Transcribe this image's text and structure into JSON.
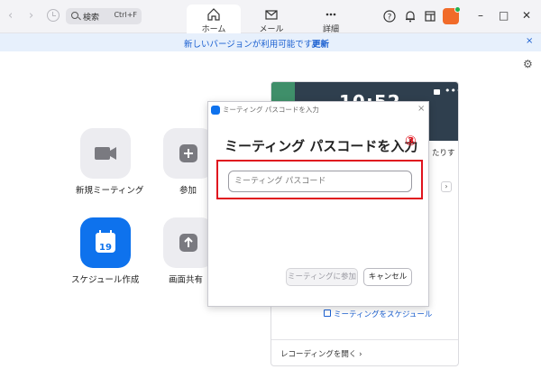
{
  "titlebar": {
    "search": {
      "label": "検索",
      "shortcut": "Ctrl+F"
    },
    "nav": [
      {
        "label": "ホーム",
        "icon": "home-icon",
        "active": true
      },
      {
        "label": "メール",
        "icon": "mail-icon",
        "active": false
      },
      {
        "label": "詳細",
        "icon": "more-icon",
        "active": false
      }
    ],
    "icons": [
      "help-icon",
      "bell-icon",
      "calendar-panel-icon",
      "avatar"
    ],
    "window_controls": {
      "minimize": "–",
      "maximize": "□",
      "close": "✕"
    }
  },
  "notice": {
    "message": "新しいバージョンが利用可能です。",
    "link": "更新",
    "close": "×"
  },
  "actions": [
    {
      "label": "新規ミーティング",
      "icon": "video-camera-icon",
      "has_dropdown": true
    },
    {
      "label": "参加",
      "icon": "plus-icon"
    },
    {
      "label": "スケジュール作成",
      "icon": "calendar-icon",
      "day": "19"
    },
    {
      "label": "画面共有",
      "icon": "share-screen-icon"
    }
  ],
  "right_panel": {
    "clock": "10:52",
    "edge_text": "たりす",
    "schedule_link": "ミーティングをスケジュール",
    "recordings_link": "レコーディングを開く",
    "recordings_chevron": "›"
  },
  "dialog": {
    "window_title": "ミーティング パスコードを入力",
    "heading": "ミーティング パスコードを入力",
    "step_marker": "③",
    "input_placeholder": "ミーティング パスコード",
    "input_value": "",
    "join_button": "ミーティングに参加",
    "cancel_button": "キャンセル",
    "close": "×"
  },
  "colors": {
    "accent": "#0e72ed",
    "notice_bg": "#e7f0fc",
    "highlight": "#e0141e",
    "avatar": "#f16b2a"
  }
}
